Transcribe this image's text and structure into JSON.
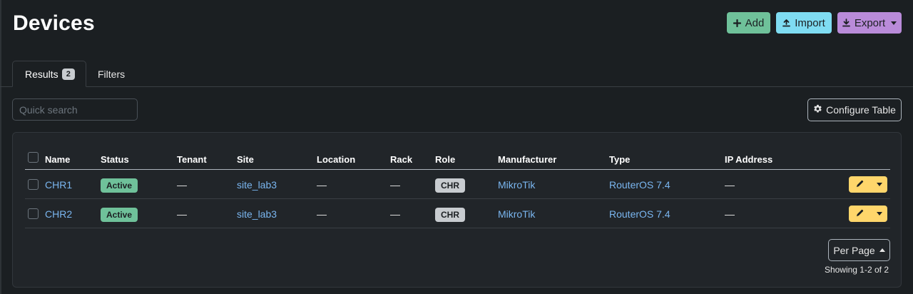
{
  "page": {
    "title": "Devices"
  },
  "actions": {
    "add_label": "Add",
    "import_label": "Import",
    "export_label": "Export"
  },
  "tabs": {
    "results_label": "Results",
    "results_count": "2",
    "filters_label": "Filters"
  },
  "search": {
    "placeholder": "Quick search"
  },
  "configure_table_label": "Configure Table",
  "table": {
    "columns": [
      "Name",
      "Status",
      "Tenant",
      "Site",
      "Location",
      "Rack",
      "Role",
      "Manufacturer",
      "Type",
      "IP Address"
    ],
    "rows": [
      {
        "name": "CHR1",
        "status": "Active",
        "tenant": "—",
        "site": "site_lab3",
        "location": "—",
        "rack": "—",
        "role": "CHR",
        "manufacturer": "MikroTik",
        "type": "RouterOS 7.4",
        "ip_address": "—"
      },
      {
        "name": "CHR2",
        "status": "Active",
        "tenant": "—",
        "site": "site_lab3",
        "location": "—",
        "rack": "—",
        "role": "CHR",
        "manufacturer": "MikroTik",
        "type": "RouterOS 7.4",
        "ip_address": "—"
      }
    ]
  },
  "pagination": {
    "per_page_label": "Per Page",
    "showing_text": "Showing 1-2 of 2"
  },
  "colors": {
    "background": "#1b1f22",
    "card": "#212529",
    "add": "#6fc19a",
    "import": "#7fdcf2",
    "export": "#b98bd9",
    "edit": "#ffd66b",
    "link": "#7ab6f0"
  },
  "icons": {
    "add": "plus-icon",
    "import": "upload-icon",
    "export": "download-icon",
    "configure": "gear-icon",
    "edit": "pencil-icon"
  }
}
